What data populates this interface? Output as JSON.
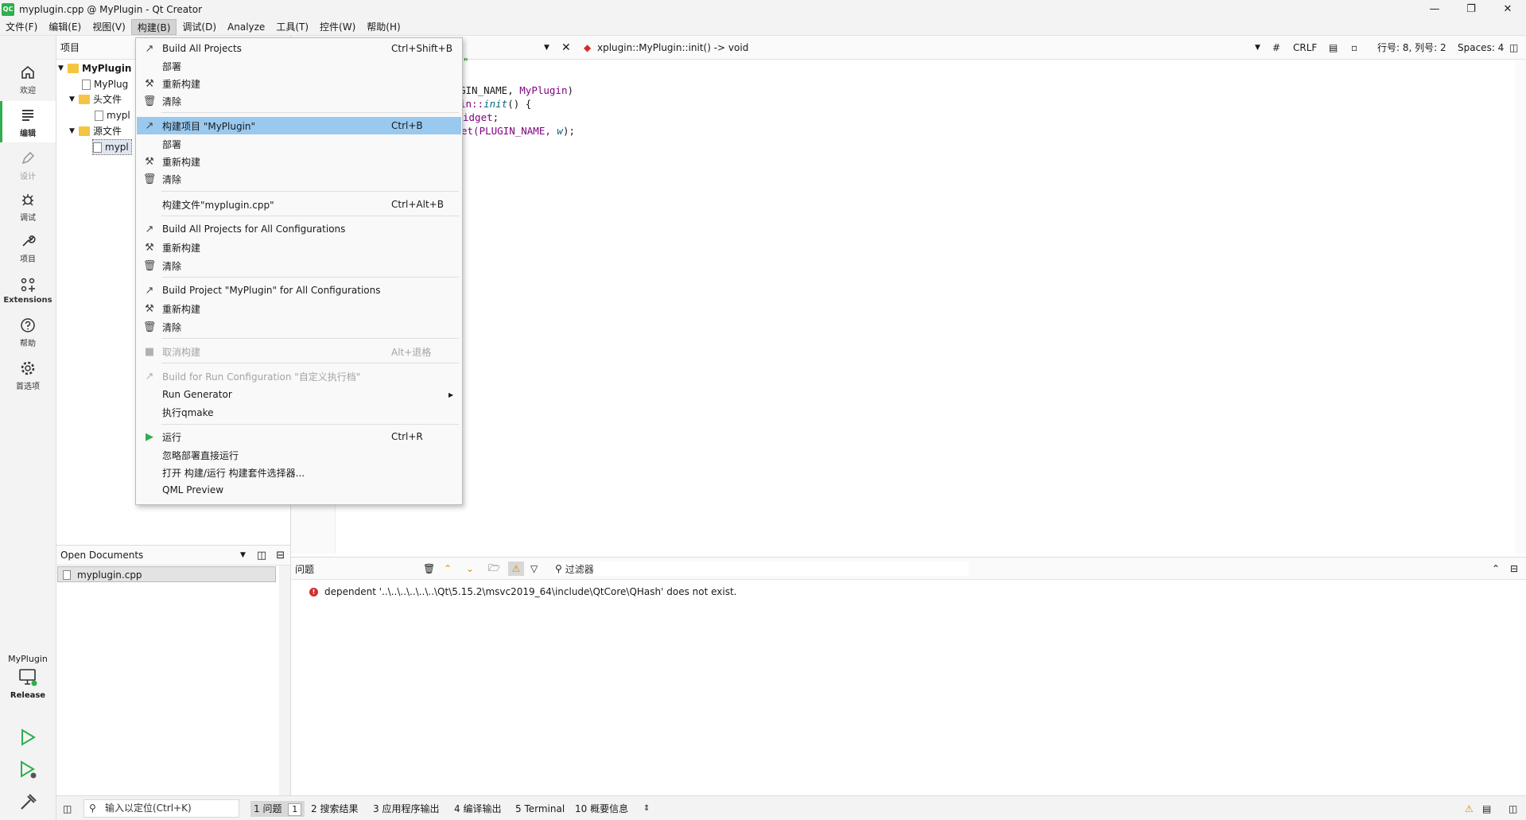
{
  "window": {
    "title": "myplugin.cpp @ MyPlugin - Qt Creator",
    "app_icon": "QC"
  },
  "menubar": {
    "items": [
      "文件(F)",
      "编辑(E)",
      "视图(V)",
      "构建(B)",
      "调试(D)",
      "Analyze",
      "工具(T)",
      "控件(W)",
      "帮助(H)"
    ],
    "active": "构建(B)"
  },
  "modes": {
    "welcome": "欢迎",
    "edit": "编辑",
    "design": "设计",
    "debug": "调试",
    "projects": "项目",
    "extensions": "Extensions",
    "help": "帮助",
    "preferences": "首选项",
    "kit_project": "MyPlugin",
    "kit_config": "Release"
  },
  "project_pane": {
    "header": "项目",
    "tree": {
      "root": "MyPlugin",
      "root_child": "MyPlug",
      "headers_folder": "头文件",
      "header_file": "mypl",
      "sources_folder": "源文件",
      "source_file": "mypl"
    }
  },
  "open_docs": {
    "header": "Open Documents",
    "file": "myplugin.cpp"
  },
  "editor_toolbar": {
    "symbol": "xplugin::MyPlugin::init() -> void",
    "hash": "#",
    "line_ending": "CRLF",
    "position": "行号: 8, 列号: 2",
    "indent": "Spaces: 4"
  },
  "code": {
    "line1": "\"",
    "line2_a": "GIN_NAME, ",
    "line2_b": "MyPlugin",
    "line2_c": ")",
    "line3_a": "in::",
    "line3_b": "init",
    "line3_c": "() {",
    "line4_a": "idget",
    "line4_b": ";",
    "line5_a": "et(PLUGIN_NAME, ",
    "line5_b": "w",
    "line5_c": ");"
  },
  "build_menu": {
    "build_all": "Build All Projects",
    "build_all_sc": "Ctrl+Shift+B",
    "deploy1": "部署",
    "rebuild1": "重新构建",
    "clean1": "清除",
    "build_project": "构建项目 \"MyPlugin\"",
    "build_project_sc": "Ctrl+B",
    "deploy2": "部署",
    "rebuild2": "重新构建",
    "clean2": "清除",
    "build_file": "构建文件\"myplugin.cpp\"",
    "build_file_sc": "Ctrl+Alt+B",
    "build_all_configs": "Build All Projects for All Configurations",
    "rebuild3": "重新构建",
    "clean3": "清除",
    "build_project_all_configs": "Build Project \"MyPlugin\" for All Configurations",
    "rebuild4": "重新构建",
    "clean4": "清除",
    "cancel_build": "取消构建",
    "cancel_build_sc": "Alt+退格",
    "build_run_config": "Build for Run Configuration \"自定义执行档\"",
    "run_generator": "Run Generator",
    "run_qmake": "执行qmake",
    "run": "运行",
    "run_sc": "Ctrl+R",
    "run_no_deploy": "忽略部署直接运行",
    "open_selector": "打开 构建/运行 构建套件选择器...",
    "qml_preview": "QML Preview"
  },
  "issues": {
    "title": "问题",
    "filter": "过滤器",
    "error_text": "dependent '..\\..\\..\\..\\..\\..\\Qt\\5.15.2\\msvc2019_64\\include\\QtCore\\QHash' does not exist."
  },
  "statusbar": {
    "locator_placeholder": "输入以定位(Ctrl+K)",
    "tab1": "1 问题",
    "tab1_count": "1",
    "tab2": "2 搜索结果",
    "tab3": "3 应用程序输出",
    "tab4": "4 编译输出",
    "tab5": "5 Terminal",
    "tab6": "10 概要信息"
  },
  "colors": {
    "accent_green": "#2fae4e",
    "menu_highlight": "#99c9ef",
    "error_red": "#d12f2f"
  }
}
